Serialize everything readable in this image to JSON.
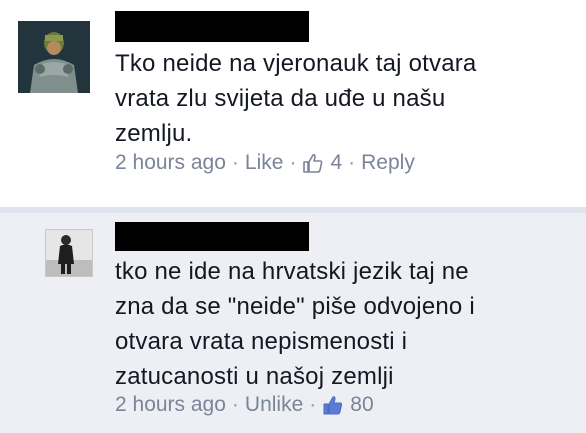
{
  "comments": [
    {
      "text": "Tko neide na vjeronauk taj otvara\nvrata zlu svijeta da uđe u našu\nzemlju.",
      "time": "2 hours ago",
      "action": "Like",
      "likes": "4",
      "reply": "Reply",
      "thumb_color": "#7c8498"
    },
    {
      "text": "tko ne ide na hrvatski jezik taj ne\nzna da se \"neide\" piše odvojeno i\notvara vrata nepismenosti i\nzatucanosti u našoj zemlji",
      "time": "2 hours ago",
      "action": "Unlike",
      "likes": "80",
      "thumb_color": "#5b7bd5"
    }
  ],
  "dot": "·"
}
